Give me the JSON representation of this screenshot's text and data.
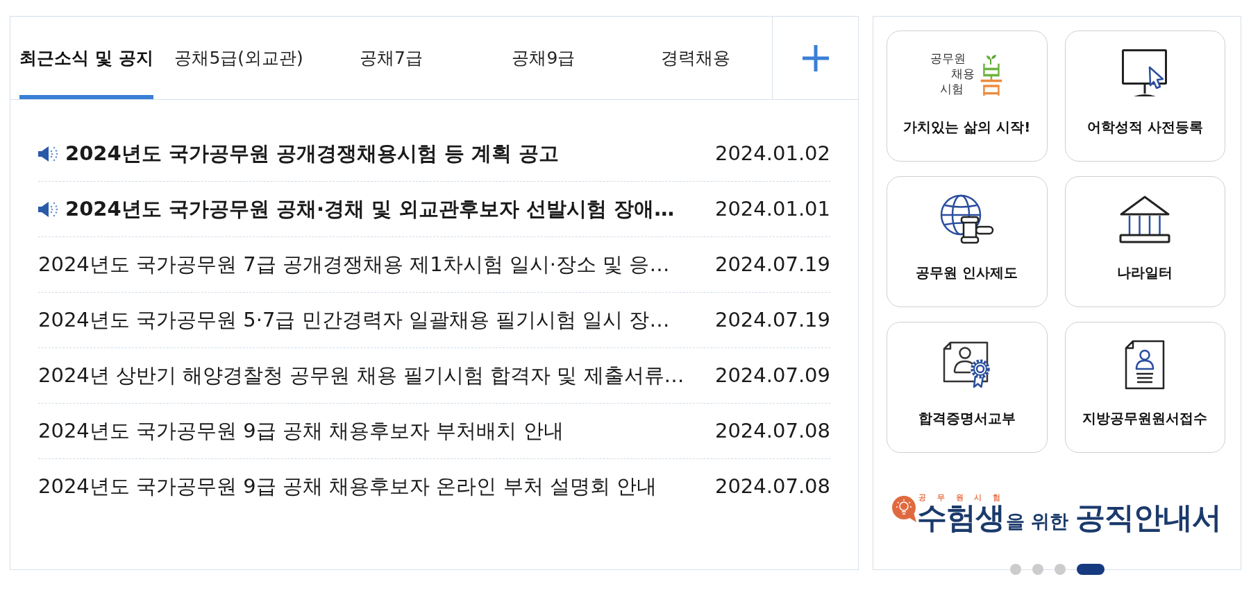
{
  "tabs": [
    {
      "label": "최근소식 및 공지",
      "selected": true
    },
    {
      "label": "공채5급(외교관)",
      "selected": false
    },
    {
      "label": "공채7급",
      "selected": false
    },
    {
      "label": "공채9급",
      "selected": false
    },
    {
      "label": "경력채용",
      "selected": false
    }
  ],
  "notices": [
    {
      "title": "2024년도 국가공무원 공개경쟁채용시험 등 계획 공고",
      "date": "2024.01.02",
      "pinned": true
    },
    {
      "title": "2024년도 국가공무원 공채·경채 및 외교관후보자 선발시험 장애…",
      "date": "2024.01.01",
      "pinned": true
    },
    {
      "title": "2024년도 국가공무원 7급 공개경쟁채용 제1차시험 일시·장소 및 응…",
      "date": "2024.07.19",
      "pinned": false
    },
    {
      "title": "2024년도 국가공무원 5·7급 민간경력자 일괄채용 필기시험 일시 장…",
      "date": "2024.07.19",
      "pinned": false
    },
    {
      "title": "2024년 상반기 해양경찰청 공무원 채용 필기시험 합격자 및 제출서류…",
      "date": "2024.07.09",
      "pinned": false
    },
    {
      "title": "2024년도 국가공무원 9급 공채 채용후보자 부처배치 안내",
      "date": "2024.07.08",
      "pinned": false
    },
    {
      "title": "2024년도 국가공무원 9급 공채 채용후보자 온라인 부처 설명회 안내",
      "date": "2024.07.08",
      "pinned": false
    }
  ],
  "quick_links": [
    {
      "label": "가치있는 삶의 시작!",
      "logo": {
        "lines": [
          "공무원",
          "채용",
          "시험"
        ],
        "mark": "봄"
      }
    },
    {
      "label": "어학성적 사전등록"
    },
    {
      "label": "공무원 인사제도"
    },
    {
      "label": "나라일터"
    },
    {
      "label": "합격증명서교부"
    },
    {
      "label": "지방공무원원서접수"
    }
  ],
  "banner": {
    "kicker": "공 무 원 시 험",
    "title": [
      {
        "text": "수험생",
        "kind": "large"
      },
      {
        "text": "을 위한",
        "kind": "small"
      },
      {
        "text": "공직안내서",
        "kind": "large"
      }
    ]
  },
  "carousel_dots": [
    {
      "selected": false
    },
    {
      "selected": false
    },
    {
      "selected": false
    },
    {
      "selected": true
    }
  ]
}
